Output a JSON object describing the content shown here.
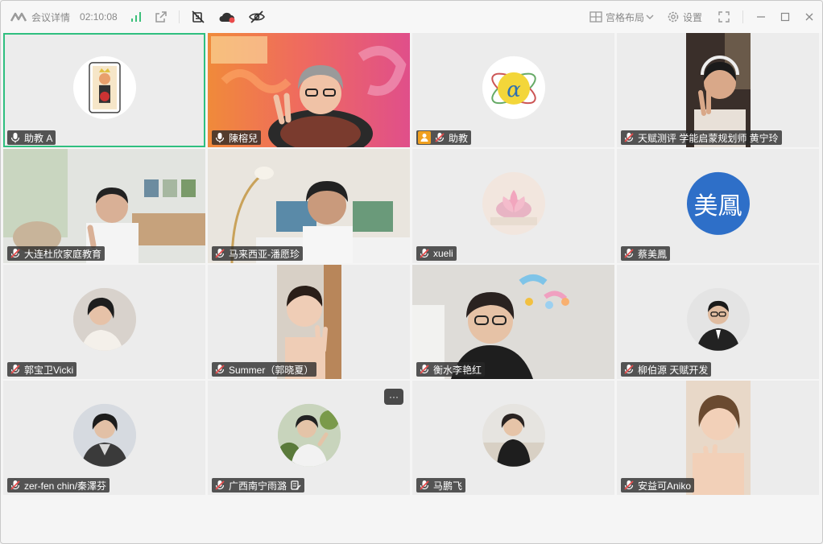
{
  "titlebar": {
    "title": "会议详情",
    "time": "02:10:08",
    "layout_label": "宫格布局",
    "settings_label": "设置"
  },
  "colors": {
    "accent": "#2fbf7f",
    "name_bg": "#2b2b2b",
    "host_badge": "#f0a020",
    "tile_bg": "#ececec"
  },
  "participants": [
    {
      "name": "助教 A",
      "mic": "on",
      "active": true
    },
    {
      "name": "陳榕兒",
      "mic": "on"
    },
    {
      "name": "助教",
      "mic": "muted",
      "host": true
    },
    {
      "name": "天赋测评 学能启蒙规划师  黄宁玲",
      "mic": "muted"
    },
    {
      "name": "大连杜欣家庭教育",
      "mic": "muted"
    },
    {
      "name": "马来西亚-潘愿珍",
      "mic": "muted"
    },
    {
      "name": "xueli",
      "mic": "muted"
    },
    {
      "name": "蔡美鳳",
      "mic": "muted",
      "avatar_text": "美鳳"
    },
    {
      "name": "郭宝卫Vicki",
      "mic": "muted"
    },
    {
      "name": "Summer（郭晓夏）",
      "mic": "muted"
    },
    {
      "name": "衡水李艳红",
      "mic": "muted"
    },
    {
      "name": "柳伯源 天赋开发",
      "mic": "muted"
    },
    {
      "name": "zer-fen chin/秦澤芬",
      "mic": "muted"
    },
    {
      "name": "广西南宁雨潞",
      "mic": "muted",
      "more": "···"
    },
    {
      "name": "马鹏飞",
      "mic": "muted"
    },
    {
      "name": "安益可Aniko",
      "mic": "muted"
    }
  ]
}
